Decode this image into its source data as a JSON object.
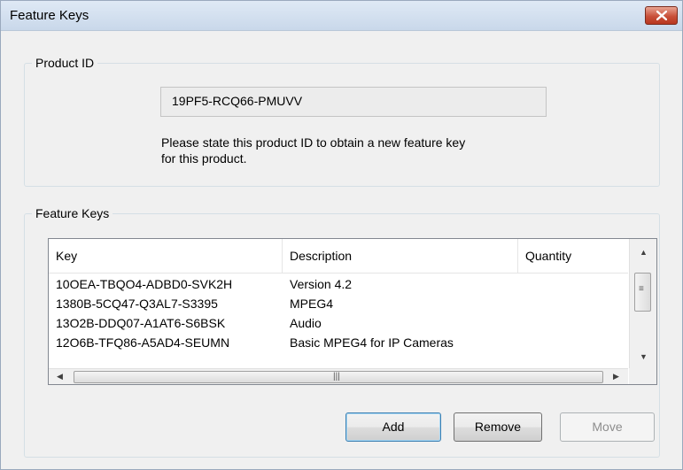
{
  "window": {
    "title": "Feature Keys"
  },
  "product_id": {
    "group_label": "Product ID",
    "value": "19PF5-RCQ66-PMUVV",
    "info_line1": "Please state this product ID to obtain a new feature key",
    "info_line2": "for this product."
  },
  "feature_keys": {
    "group_label": "Feature Keys",
    "columns": [
      "Key",
      "Description",
      "Quantity"
    ],
    "rows": [
      {
        "key": "10OEA-TBQO4-ADBD0-SVK2H",
        "description": "Version 4.2",
        "quantity": ""
      },
      {
        "key": "1380B-5CQ47-Q3AL7-S3395",
        "description": "MPEG4",
        "quantity": ""
      },
      {
        "key": "13O2B-DDQ07-A1AT6-S6BSK",
        "description": "Audio",
        "quantity": ""
      },
      {
        "key": "12O6B-TFQ86-A5AD4-SEUMN",
        "description": "Basic MPEG4 for IP Cameras",
        "quantity": ""
      }
    ]
  },
  "buttons": {
    "add": "Add",
    "remove": "Remove",
    "move": "Move"
  },
  "icons": {
    "close": "close-icon",
    "scroll_up": "arrow-up-icon",
    "scroll_down": "arrow-down-icon",
    "scroll_left": "arrow-left-icon",
    "scroll_right": "arrow-right-icon"
  }
}
